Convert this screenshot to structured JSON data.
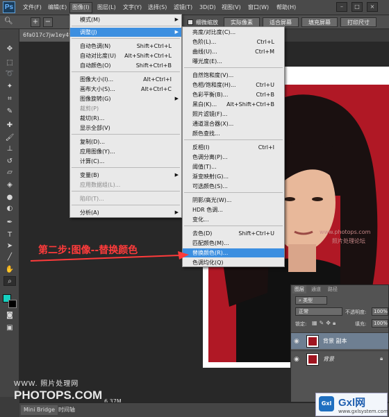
{
  "app": {
    "logo": "Ps",
    "doc_tab": "6fa017c7jw1ey4fx"
  },
  "menubar": {
    "items": [
      "文件(F)",
      "编辑(E)",
      "图像(I)",
      "图层(L)",
      "文字(Y)",
      "选择(S)",
      "滤镜(T)",
      "3D(D)",
      "视图(V)",
      "窗口(W)",
      "帮助(H)"
    ],
    "active_index": 2
  },
  "options": {
    "zoom_in": "+",
    "zoom_out": "−",
    "fine_zoom": "细微缩放",
    "actual_pixels": "实际像素",
    "fit_screen": "适合屏幕",
    "fill_screen": "填充屏幕",
    "print_size": "打印尺寸"
  },
  "image_menu": {
    "items": [
      {
        "label": "模式(M)",
        "sub": true
      },
      {
        "label": "调整(J)",
        "sub": true,
        "highlight": true
      },
      {
        "label": "自动色调(N)",
        "shortcut": "Shift+Ctrl+L"
      },
      {
        "label": "自动对比度(U)",
        "shortcut": "Alt+Shift+Ctrl+L"
      },
      {
        "label": "自动颜色(O)",
        "shortcut": "Shift+Ctrl+B"
      },
      {
        "label": "图像大小(I)...",
        "shortcut": "Alt+Ctrl+I"
      },
      {
        "label": "画布大小(S)...",
        "shortcut": "Alt+Ctrl+C"
      },
      {
        "label": "图像旋转(G)",
        "sub": true
      },
      {
        "label": "裁剪(P)",
        "disabled": true
      },
      {
        "label": "裁切(R)..."
      },
      {
        "label": "显示全部(V)"
      },
      {
        "label": "复制(D)..."
      },
      {
        "label": "应用图像(Y)..."
      },
      {
        "label": "计算(C)..."
      },
      {
        "label": "变量(B)",
        "sub": true
      },
      {
        "label": "应用数据组(L)...",
        "disabled": true
      },
      {
        "label": "陷印(T)...",
        "disabled": true
      },
      {
        "label": "分析(A)",
        "sub": true
      }
    ]
  },
  "adjust_menu": {
    "items": [
      {
        "label": "亮度/对比度(C)..."
      },
      {
        "label": "色阶(L)...",
        "shortcut": "Ctrl+L"
      },
      {
        "label": "曲线(U)...",
        "shortcut": "Ctrl+M"
      },
      {
        "label": "曝光度(E)..."
      },
      {
        "label": "自然饱和度(V)..."
      },
      {
        "label": "色相/饱和度(H)...",
        "shortcut": "Ctrl+U"
      },
      {
        "label": "色彩平衡(B)...",
        "shortcut": "Ctrl+B"
      },
      {
        "label": "黑白(K)...",
        "shortcut": "Alt+Shift+Ctrl+B"
      },
      {
        "label": "照片滤镜(F)..."
      },
      {
        "label": "通道混合器(X)..."
      },
      {
        "label": "颜色查找..."
      },
      {
        "label": "反相(I)",
        "shortcut": "Ctrl+I"
      },
      {
        "label": "色调分离(P)..."
      },
      {
        "label": "阈值(T)..."
      },
      {
        "label": "渐变映射(G)..."
      },
      {
        "label": "可选颜色(S)..."
      },
      {
        "label": "阴影/高光(W)..."
      },
      {
        "label": "HDR 色调..."
      },
      {
        "label": "变化..."
      },
      {
        "label": "去色(D)",
        "shortcut": "Shift+Ctrl+U"
      },
      {
        "label": "匹配颜色(M)..."
      },
      {
        "label": "替换颜色(R)...",
        "highlight": true
      },
      {
        "label": "色调均化(Q)"
      }
    ]
  },
  "annotation": "第二步:图像--替换颜色",
  "layers": {
    "tabs": [
      "图层",
      "通道",
      "路径"
    ],
    "kind": "类型",
    "blend": "正常",
    "opacity_label": "不透明度:",
    "opacity": "100%",
    "lock_label": "锁定:",
    "fill_label": "填充:",
    "fill": "100%",
    "rows": [
      {
        "name": "背景 副本",
        "selected": true
      },
      {
        "name": "背景",
        "italic": true
      }
    ]
  },
  "status": {
    "doc_info": "6.37M"
  },
  "bottom_tabs": [
    "Mini Bridge",
    "时间轴"
  ],
  "watermarks": {
    "left_top": "WWW.   照片处理网",
    "left_big": "PHOTOPS.COM",
    "photo_wm1": "www.photops.com",
    "photo_wm2": "照片处理论坛",
    "gxl_brand": "Gxl网",
    "gxl_url": "www.gxlsystem.com"
  },
  "colors": {
    "accent": "#3c8fe0",
    "backdrop": "#b01825",
    "annotation": "#ff3b3b"
  }
}
